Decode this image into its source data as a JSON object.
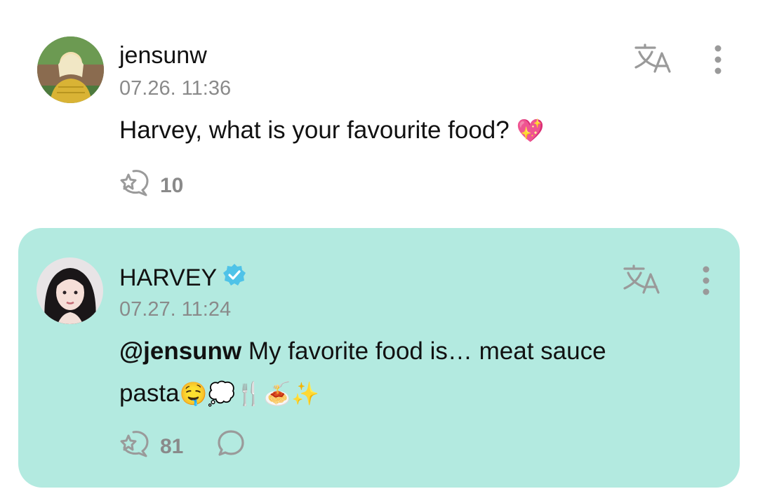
{
  "colors": {
    "artist_bubble_bg": "#b3eae0",
    "secondary_text": "#8a8a8a",
    "icon_gray": "#9a9a9a",
    "verified_badge": "#4fc3e8",
    "heart_emoji": "#ff4fa3"
  },
  "icons": {
    "translate": "translate-icon",
    "more": "more-vertical-icon",
    "reaction": "bubble-reaction-icon",
    "reply": "speech-bubble-icon",
    "verified": "verified-badge-icon"
  },
  "posts": [
    {
      "username": "jensunw",
      "timestamp": "07.26. 11:36",
      "text": "Harvey, what is your favourite food? ",
      "emoji": "💖",
      "reaction_count": "10"
    },
    {
      "username": "HARVEY",
      "verified": true,
      "timestamp": "07.27. 11:24",
      "mention": "@jensunw",
      "text_line1": " My favorite food is… meat sauce",
      "text_line2": "pasta",
      "emoji": "🤤💭🍴🍝✨",
      "reaction_count": "81"
    }
  ]
}
